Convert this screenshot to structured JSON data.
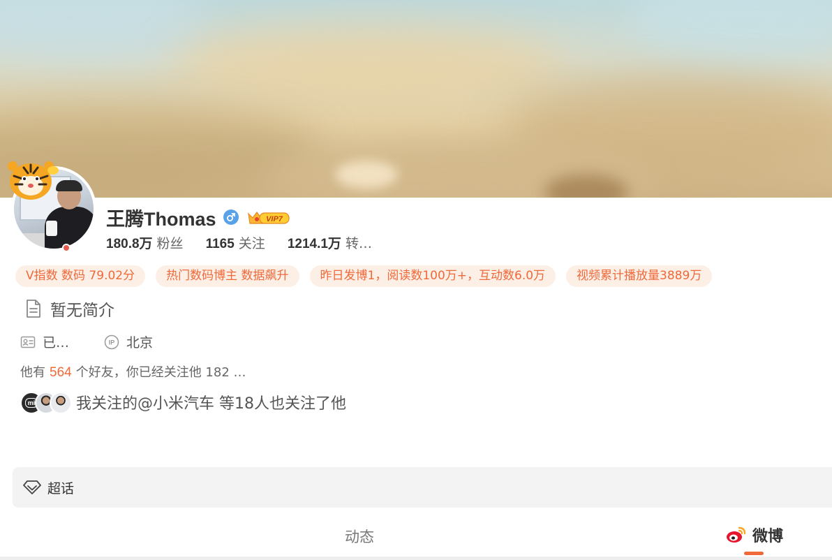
{
  "profile": {
    "name": "王腾Thomas",
    "vip_label": "VIP7",
    "stats": [
      {
        "value": "180.8万",
        "label": "粉丝"
      },
      {
        "value": "1165",
        "label": "关注"
      },
      {
        "value": "1214.1万",
        "label": "转…"
      }
    ]
  },
  "tags": [
    "V指数 数码 79.02分",
    "热门数码博主 数据飙升",
    "昨日发博1，阅读数100万+，互动数6.0万",
    "视频累计播放量3889万"
  ],
  "bio": "暂无简介",
  "meta": {
    "verify": "已…",
    "ip_location": "北京"
  },
  "friends": {
    "prefix": "他有",
    "count": "564",
    "suffix": "个好友，你已经关注他 182 …"
  },
  "mutual": {
    "mi_logo": "mi",
    "text": "我关注的@小米汽车 等18人也关注了他"
  },
  "super_topic": {
    "label": "超话"
  },
  "tabs": {
    "dynamic": "动态",
    "weibo": "微博"
  },
  "colors": {
    "accent": "#f0693a",
    "tag_bg": "#fcefe6",
    "gender_blue": "#5aa2e8"
  },
  "icons": [
    "gender-male-icon",
    "vip-crown-icon",
    "document-icon",
    "id-card-icon",
    "ip-icon",
    "diamond-icon",
    "weibo-logo-icon",
    "tiger-avatar-frame-icon"
  ]
}
